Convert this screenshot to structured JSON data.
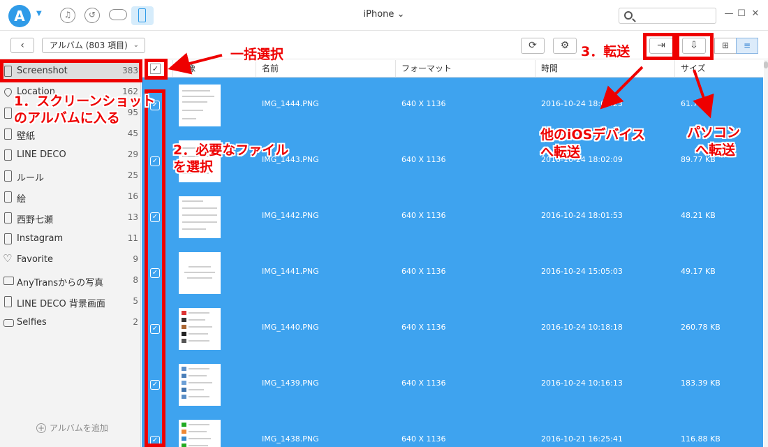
{
  "titlebar": {
    "logo_letter": "A",
    "title": "iPhone",
    "title_caret": "⌄",
    "search_placeholder": "",
    "window_buttons": {
      "minimize": "—",
      "maximize": "☐",
      "close": "✕"
    }
  },
  "toolbar": {
    "back": "‹",
    "album_select": "アルバム (803 項目)",
    "refresh": "⟳",
    "settings": "⚙",
    "to_device": "⇥",
    "to_computer": "⇩",
    "grid_view": "⊞",
    "list_view": "≡"
  },
  "sidebar": {
    "items": [
      {
        "label": "Screenshot",
        "count": "383",
        "icon": "phone-icon"
      },
      {
        "label": "Location",
        "count": "162",
        "icon": "location-icon"
      },
      {
        "label": "",
        "count": "95",
        "icon": "phone-icon"
      },
      {
        "label": "壁紙",
        "count": "45",
        "icon": "phone-icon"
      },
      {
        "label": "LINE DECO",
        "count": "29",
        "icon": "phone-icon"
      },
      {
        "label": "ルール",
        "count": "25",
        "icon": "phone-icon"
      },
      {
        "label": "絵",
        "count": "16",
        "icon": "phone-icon"
      },
      {
        "label": "西野七瀬",
        "count": "13",
        "icon": "phone-icon"
      },
      {
        "label": "Instagram",
        "count": "11",
        "icon": "phone-icon"
      },
      {
        "label": "Favorite",
        "count": "9",
        "icon": "heart-icon"
      },
      {
        "label": "AnyTransからの写真",
        "count": "8",
        "icon": "photo-icon"
      },
      {
        "label": "LINE DECO 背景画面",
        "count": "5",
        "icon": "phone-icon"
      },
      {
        "label": "Selfies",
        "count": "2",
        "icon": "camera-icon"
      }
    ],
    "add_album": "アルバムを追加",
    "add_plus": "+"
  },
  "table": {
    "header_check": "✓",
    "columns": [
      "画像",
      "名前",
      "フォーマット",
      "時間",
      "サイズ"
    ],
    "rows": [
      {
        "name": "IMG_1444.PNG",
        "format": "640 X 1136",
        "time": "2016-10-24 18:02:23",
        "size": "61.7 KB",
        "check": "✓"
      },
      {
        "name": "IMG_1443.PNG",
        "format": "640 X 1136",
        "time": "2016-10-24 18:02:09",
        "size": "89.77 KB",
        "check": "✓"
      },
      {
        "name": "IMG_1442.PNG",
        "format": "640 X 1136",
        "time": "2016-10-24 18:01:53",
        "size": "48.21 KB",
        "check": "✓"
      },
      {
        "name": "IMG_1441.PNG",
        "format": "640 X 1136",
        "time": "2016-10-24 15:05:03",
        "size": "49.17 KB",
        "check": "✓"
      },
      {
        "name": "IMG_1440.PNG",
        "format": "640 X 1136",
        "time": "2016-10-24 10:18:18",
        "size": "260.78 KB",
        "check": "✓"
      },
      {
        "name": "IMG_1439.PNG",
        "format": "640 X 1136",
        "time": "2016-10-24 10:16:13",
        "size": "183.39 KB",
        "check": "✓"
      },
      {
        "name": "IMG_1438.PNG",
        "format": "640 X 1136",
        "time": "2016-10-21 16:25:41",
        "size": "116.88 KB",
        "check": "✓"
      }
    ]
  },
  "annotations": {
    "select_all": "一括選択",
    "step1_line1": "1．スクリーンショット",
    "step1_line2": "のアルバムに入る",
    "step2_line1": "2．必要なファイル",
    "step2_line2": "を選択",
    "step3": "3．転送",
    "to_ios_line1": "他のiOSデバイス",
    "to_ios_line2": "へ転送",
    "to_pc_line1": "パソコン",
    "to_pc_line2": "へ転送"
  },
  "colors": {
    "accent": "#2f9be8",
    "selection": "#3ea3ef",
    "annotation": "#ee0000"
  }
}
